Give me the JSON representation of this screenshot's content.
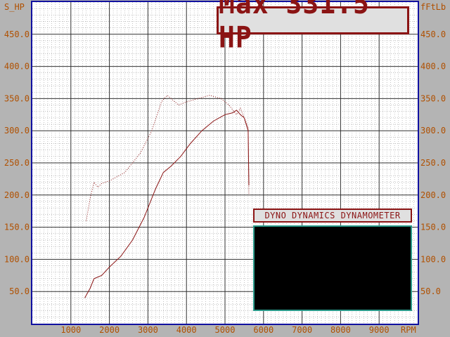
{
  "header": {
    "max_readout": "Max 331.5 HP",
    "brand": "DYNO DYNAMICS DYNAMOMETER"
  },
  "colors": {
    "background": "#b4b4b4",
    "plot_background": "#ffffff",
    "frame": "#1010a0",
    "tick_text": "#b05000",
    "curve": "#8b1414",
    "panel_border": "#2a9a8a"
  },
  "chart_data": {
    "type": "line",
    "title": "",
    "xlabel": "RPM",
    "ylabel": "S_HP",
    "ylabel_right": "fFtLb",
    "xlim": [
      0,
      10000
    ],
    "ylim": [
      0,
      500
    ],
    "x_ticks": [
      1000,
      2000,
      3000,
      4000,
      5000,
      6000,
      7000,
      8000,
      9000
    ],
    "x_tick_labels": [
      "1000",
      "2000",
      "3000",
      "4000",
      "5000",
      "6000",
      "7000",
      "8000",
      "9000"
    ],
    "y_ticks": [
      50,
      100,
      150,
      200,
      250,
      300,
      350,
      400,
      450
    ],
    "y_tick_labels": [
      "50.0",
      "100.0",
      "150.0",
      "200.0",
      "250.0",
      "300.0",
      "350.0",
      "400.0",
      "450.0"
    ],
    "grid": true,
    "series": [
      {
        "name": "",
        "style": "solid",
        "x": [
          1360,
          1500,
          1600,
          1800,
          2000,
          2300,
          2600,
          2900,
          3200,
          3400,
          3600,
          3850,
          4100,
          4400,
          4700,
          5000,
          5200,
          5300,
          5400,
          5500,
          5600,
          5620
        ],
        "y": [
          40,
          55,
          70,
          75,
          88,
          105,
          130,
          165,
          210,
          235,
          245,
          260,
          280,
          300,
          315,
          325,
          328,
          332,
          325,
          320,
          300,
          215
        ]
      },
      {
        "name": "",
        "style": "dotted",
        "x": [
          1400,
          1500,
          1600,
          1700,
          1800,
          2000,
          2400,
          2800,
          3100,
          3350,
          3500,
          3600,
          3800,
          4000,
          4300,
          4600,
          4900,
          5100,
          5300,
          5400,
          5500,
          5600,
          5620
        ],
        "y": [
          160,
          195,
          220,
          212,
          218,
          222,
          235,
          265,
          300,
          345,
          355,
          350,
          340,
          345,
          350,
          355,
          350,
          340,
          325,
          335,
          320,
          305,
          200
        ]
      }
    ]
  }
}
